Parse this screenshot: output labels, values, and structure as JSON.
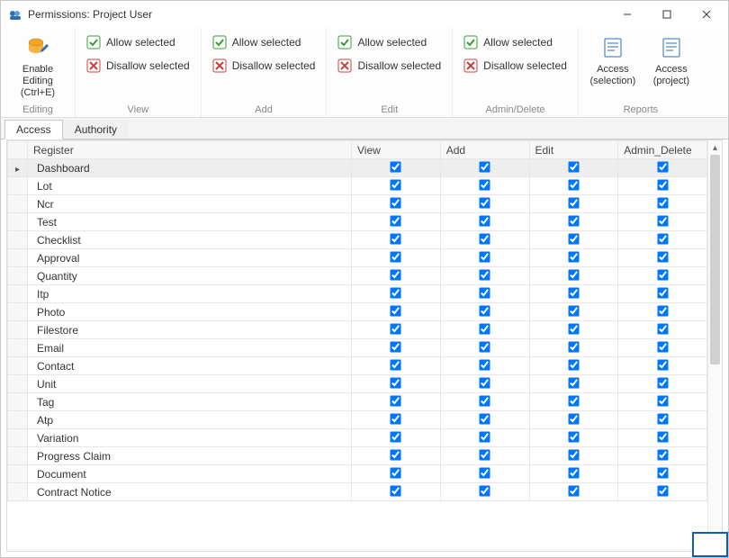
{
  "window": {
    "title": "Permissions: Project User"
  },
  "ribbon": {
    "editing": {
      "label": "Editing",
      "enable_editing": "Enable Editing (Ctrl+E)"
    },
    "view": {
      "label": "View",
      "allow": "Allow selected",
      "disallow": "Disallow selected"
    },
    "add": {
      "label": "Add",
      "allow": "Allow selected",
      "disallow": "Disallow selected"
    },
    "edit": {
      "label": "Edit",
      "allow": "Allow selected",
      "disallow": "Disallow selected"
    },
    "admin": {
      "label": "Admin/Delete",
      "allow": "Allow selected",
      "disallow": "Disallow selected"
    },
    "reports": {
      "label": "Reports",
      "access_selection": "Access (selection)",
      "access_project": "Access (project)"
    }
  },
  "tabs": {
    "access": "Access",
    "authority": "Authority"
  },
  "columns": {
    "register": "Register",
    "view": "View",
    "add": "Add",
    "edit": "Edit",
    "admin": "Admin_Delete"
  },
  "rows": [
    {
      "register": "Dashboard",
      "view": true,
      "add": true,
      "edit": true,
      "admin": true,
      "selected": true
    },
    {
      "register": "Lot",
      "view": true,
      "add": true,
      "edit": true,
      "admin": true
    },
    {
      "register": "Ncr",
      "view": true,
      "add": true,
      "edit": true,
      "admin": true
    },
    {
      "register": "Test",
      "view": true,
      "add": true,
      "edit": true,
      "admin": true
    },
    {
      "register": "Checklist",
      "view": true,
      "add": true,
      "edit": true,
      "admin": true
    },
    {
      "register": "Approval",
      "view": true,
      "add": true,
      "edit": true,
      "admin": true
    },
    {
      "register": "Quantity",
      "view": true,
      "add": true,
      "edit": true,
      "admin": true
    },
    {
      "register": "Itp",
      "view": true,
      "add": true,
      "edit": true,
      "admin": true
    },
    {
      "register": "Photo",
      "view": true,
      "add": true,
      "edit": true,
      "admin": true
    },
    {
      "register": "Filestore",
      "view": true,
      "add": true,
      "edit": true,
      "admin": true
    },
    {
      "register": "Email",
      "view": true,
      "add": true,
      "edit": true,
      "admin": true
    },
    {
      "register": "Contact",
      "view": true,
      "add": true,
      "edit": true,
      "admin": true
    },
    {
      "register": "Unit",
      "view": true,
      "add": true,
      "edit": true,
      "admin": true
    },
    {
      "register": "Tag",
      "view": true,
      "add": true,
      "edit": true,
      "admin": true
    },
    {
      "register": "Atp",
      "view": true,
      "add": true,
      "edit": true,
      "admin": true
    },
    {
      "register": "Variation",
      "view": true,
      "add": true,
      "edit": true,
      "admin": true
    },
    {
      "register": "Progress Claim",
      "view": true,
      "add": true,
      "edit": true,
      "admin": true
    },
    {
      "register": "Document",
      "view": true,
      "add": true,
      "edit": true,
      "admin": true
    },
    {
      "register": "Contract Notice",
      "view": true,
      "add": true,
      "edit": true,
      "admin": true
    }
  ],
  "icons": {
    "app": "permissions-icon",
    "allow": "allow-icon",
    "disallow": "disallow-icon",
    "enable_edit": "database-edit-icon",
    "report": "report-icon"
  }
}
